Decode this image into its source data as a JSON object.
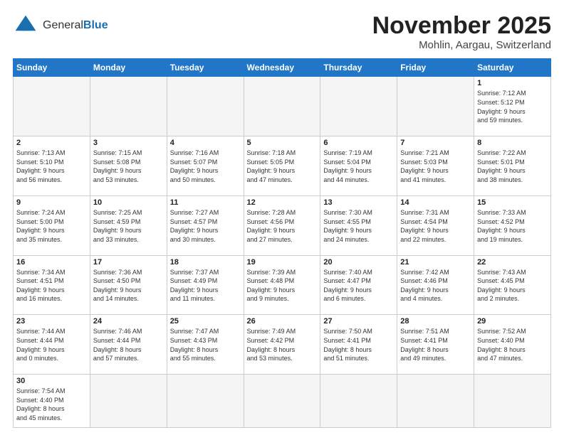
{
  "header": {
    "logo_general": "General",
    "logo_blue": "Blue",
    "month_title": "November 2025",
    "location": "Mohlin, Aargau, Switzerland"
  },
  "days_of_week": [
    "Sunday",
    "Monday",
    "Tuesday",
    "Wednesday",
    "Thursday",
    "Friday",
    "Saturday"
  ],
  "weeks": [
    [
      {
        "num": "",
        "info": "",
        "empty": true
      },
      {
        "num": "",
        "info": "",
        "empty": true
      },
      {
        "num": "",
        "info": "",
        "empty": true
      },
      {
        "num": "",
        "info": "",
        "empty": true
      },
      {
        "num": "",
        "info": "",
        "empty": true
      },
      {
        "num": "",
        "info": "",
        "empty": true
      },
      {
        "num": "1",
        "info": "Sunrise: 7:12 AM\nSunset: 5:12 PM\nDaylight: 9 hours\nand 59 minutes.",
        "empty": false
      }
    ],
    [
      {
        "num": "2",
        "info": "Sunrise: 7:13 AM\nSunset: 5:10 PM\nDaylight: 9 hours\nand 56 minutes.",
        "empty": false
      },
      {
        "num": "3",
        "info": "Sunrise: 7:15 AM\nSunset: 5:08 PM\nDaylight: 9 hours\nand 53 minutes.",
        "empty": false
      },
      {
        "num": "4",
        "info": "Sunrise: 7:16 AM\nSunset: 5:07 PM\nDaylight: 9 hours\nand 50 minutes.",
        "empty": false
      },
      {
        "num": "5",
        "info": "Sunrise: 7:18 AM\nSunset: 5:05 PM\nDaylight: 9 hours\nand 47 minutes.",
        "empty": false
      },
      {
        "num": "6",
        "info": "Sunrise: 7:19 AM\nSunset: 5:04 PM\nDaylight: 9 hours\nand 44 minutes.",
        "empty": false
      },
      {
        "num": "7",
        "info": "Sunrise: 7:21 AM\nSunset: 5:03 PM\nDaylight: 9 hours\nand 41 minutes.",
        "empty": false
      },
      {
        "num": "8",
        "info": "Sunrise: 7:22 AM\nSunset: 5:01 PM\nDaylight: 9 hours\nand 38 minutes.",
        "empty": false
      }
    ],
    [
      {
        "num": "9",
        "info": "Sunrise: 7:24 AM\nSunset: 5:00 PM\nDaylight: 9 hours\nand 35 minutes.",
        "empty": false
      },
      {
        "num": "10",
        "info": "Sunrise: 7:25 AM\nSunset: 4:59 PM\nDaylight: 9 hours\nand 33 minutes.",
        "empty": false
      },
      {
        "num": "11",
        "info": "Sunrise: 7:27 AM\nSunset: 4:57 PM\nDaylight: 9 hours\nand 30 minutes.",
        "empty": false
      },
      {
        "num": "12",
        "info": "Sunrise: 7:28 AM\nSunset: 4:56 PM\nDaylight: 9 hours\nand 27 minutes.",
        "empty": false
      },
      {
        "num": "13",
        "info": "Sunrise: 7:30 AM\nSunset: 4:55 PM\nDaylight: 9 hours\nand 24 minutes.",
        "empty": false
      },
      {
        "num": "14",
        "info": "Sunrise: 7:31 AM\nSunset: 4:54 PM\nDaylight: 9 hours\nand 22 minutes.",
        "empty": false
      },
      {
        "num": "15",
        "info": "Sunrise: 7:33 AM\nSunset: 4:52 PM\nDaylight: 9 hours\nand 19 minutes.",
        "empty": false
      }
    ],
    [
      {
        "num": "16",
        "info": "Sunrise: 7:34 AM\nSunset: 4:51 PM\nDaylight: 9 hours\nand 16 minutes.",
        "empty": false
      },
      {
        "num": "17",
        "info": "Sunrise: 7:36 AM\nSunset: 4:50 PM\nDaylight: 9 hours\nand 14 minutes.",
        "empty": false
      },
      {
        "num": "18",
        "info": "Sunrise: 7:37 AM\nSunset: 4:49 PM\nDaylight: 9 hours\nand 11 minutes.",
        "empty": false
      },
      {
        "num": "19",
        "info": "Sunrise: 7:39 AM\nSunset: 4:48 PM\nDaylight: 9 hours\nand 9 minutes.",
        "empty": false
      },
      {
        "num": "20",
        "info": "Sunrise: 7:40 AM\nSunset: 4:47 PM\nDaylight: 9 hours\nand 6 minutes.",
        "empty": false
      },
      {
        "num": "21",
        "info": "Sunrise: 7:42 AM\nSunset: 4:46 PM\nDaylight: 9 hours\nand 4 minutes.",
        "empty": false
      },
      {
        "num": "22",
        "info": "Sunrise: 7:43 AM\nSunset: 4:45 PM\nDaylight: 9 hours\nand 2 minutes.",
        "empty": false
      }
    ],
    [
      {
        "num": "23",
        "info": "Sunrise: 7:44 AM\nSunset: 4:44 PM\nDaylight: 9 hours\nand 0 minutes.",
        "empty": false
      },
      {
        "num": "24",
        "info": "Sunrise: 7:46 AM\nSunset: 4:44 PM\nDaylight: 8 hours\nand 57 minutes.",
        "empty": false
      },
      {
        "num": "25",
        "info": "Sunrise: 7:47 AM\nSunset: 4:43 PM\nDaylight: 8 hours\nand 55 minutes.",
        "empty": false
      },
      {
        "num": "26",
        "info": "Sunrise: 7:49 AM\nSunset: 4:42 PM\nDaylight: 8 hours\nand 53 minutes.",
        "empty": false
      },
      {
        "num": "27",
        "info": "Sunrise: 7:50 AM\nSunset: 4:41 PM\nDaylight: 8 hours\nand 51 minutes.",
        "empty": false
      },
      {
        "num": "28",
        "info": "Sunrise: 7:51 AM\nSunset: 4:41 PM\nDaylight: 8 hours\nand 49 minutes.",
        "empty": false
      },
      {
        "num": "29",
        "info": "Sunrise: 7:52 AM\nSunset: 4:40 PM\nDaylight: 8 hours\nand 47 minutes.",
        "empty": false
      }
    ],
    [
      {
        "num": "30",
        "info": "Sunrise: 7:54 AM\nSunset: 4:40 PM\nDaylight: 8 hours\nand 45 minutes.",
        "empty": false
      },
      {
        "num": "",
        "info": "",
        "empty": true
      },
      {
        "num": "",
        "info": "",
        "empty": true
      },
      {
        "num": "",
        "info": "",
        "empty": true
      },
      {
        "num": "",
        "info": "",
        "empty": true
      },
      {
        "num": "",
        "info": "",
        "empty": true
      },
      {
        "num": "",
        "info": "",
        "empty": true
      }
    ]
  ]
}
